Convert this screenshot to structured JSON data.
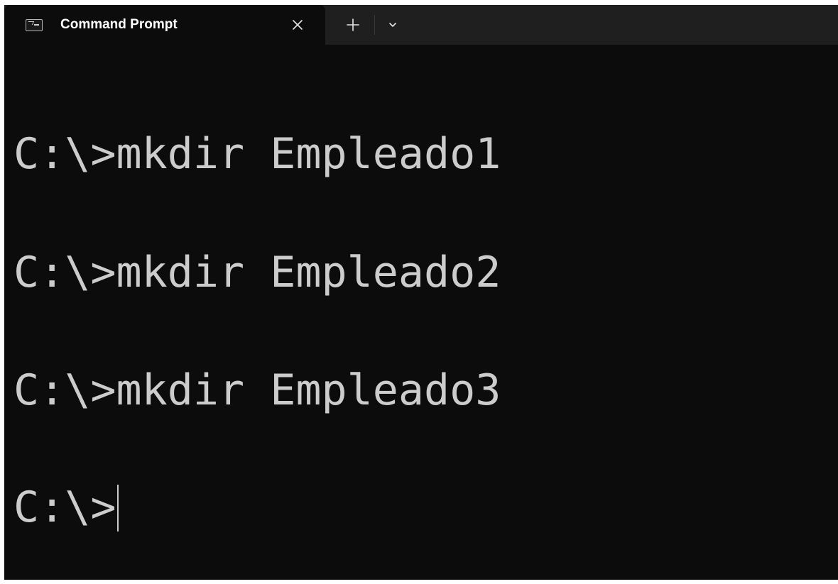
{
  "tab": {
    "title": "Command Prompt",
    "icon": "command-prompt-icon",
    "close_icon": "close-icon",
    "new_tab_icon": "plus-icon",
    "dropdown_icon": "chevron-down-icon"
  },
  "terminal": {
    "lines": [
      "C:\\>mkdir Empleado1",
      "C:\\>mkdir Empleado2",
      "C:\\>mkdir Empleado3"
    ],
    "prompt": "C:\\>"
  },
  "colors": {
    "background": "#0c0c0c",
    "tabstrip": "#1f1f1f",
    "text": "#cccccc"
  }
}
